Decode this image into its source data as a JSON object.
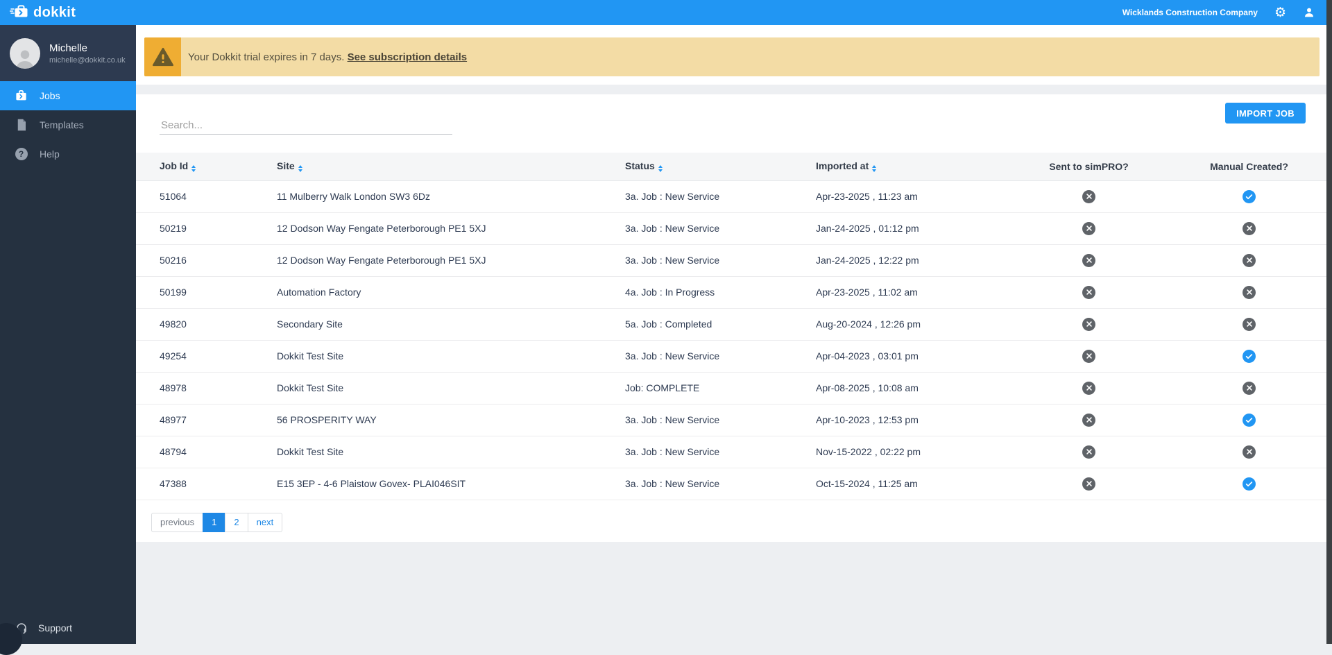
{
  "header": {
    "brand": "dokkit",
    "company": "Wicklands Construction Company"
  },
  "sidebar": {
    "user": {
      "name": "Michelle",
      "email": "michelle@dokkit.co.uk"
    },
    "items": [
      {
        "label": "Jobs",
        "icon": "briefcase-icon",
        "active": true
      },
      {
        "label": "Templates",
        "icon": "file-icon",
        "active": false
      },
      {
        "label": "Help",
        "icon": "question-icon",
        "active": false
      }
    ],
    "support_label": "Support"
  },
  "banner": {
    "message": "Your Dokkit trial expires in 7 days.",
    "link": "See subscription details"
  },
  "toolbar": {
    "search_placeholder": "Search...",
    "import_button": "IMPORT JOB"
  },
  "table": {
    "columns": [
      {
        "label": "Job Id",
        "sortable": true,
        "align": "left"
      },
      {
        "label": "Site",
        "sortable": true,
        "align": "left"
      },
      {
        "label": "Status",
        "sortable": true,
        "align": "left"
      },
      {
        "label": "Imported at",
        "sortable": true,
        "align": "left"
      },
      {
        "label": "Sent to simPRO?",
        "sortable": false,
        "align": "center"
      },
      {
        "label": "Manual Created?",
        "sortable": false,
        "align": "center"
      }
    ],
    "rows": [
      {
        "job_id": "51064",
        "site": "11 Mulberry Walk London SW3 6Dz",
        "status": "3a. Job : New Service",
        "imported_at": "Apr-23-2025 , 11:23 am",
        "sent_to_simpro": false,
        "manual_created": true
      },
      {
        "job_id": "50219",
        "site": "12 Dodson Way Fengate Peterborough PE1 5XJ",
        "status": "3a. Job : New Service",
        "imported_at": "Jan-24-2025 , 01:12 pm",
        "sent_to_simpro": false,
        "manual_created": false
      },
      {
        "job_id": "50216",
        "site": "12 Dodson Way Fengate Peterborough PE1 5XJ",
        "status": "3a. Job : New Service",
        "imported_at": "Jan-24-2025 , 12:22 pm",
        "sent_to_simpro": false,
        "manual_created": false
      },
      {
        "job_id": "50199",
        "site": "Automation Factory",
        "status": "4a. Job : In Progress",
        "imported_at": "Apr-23-2025 , 11:02 am",
        "sent_to_simpro": false,
        "manual_created": false
      },
      {
        "job_id": "49820",
        "site": "Secondary Site",
        "status": "5a. Job : Completed",
        "imported_at": "Aug-20-2024 , 12:26 pm",
        "sent_to_simpro": false,
        "manual_created": false
      },
      {
        "job_id": "49254",
        "site": "Dokkit Test Site",
        "status": "3a. Job : New Service",
        "imported_at": "Apr-04-2023 , 03:01 pm",
        "sent_to_simpro": false,
        "manual_created": true
      },
      {
        "job_id": "48978",
        "site": "Dokkit Test Site",
        "status": "Job: COMPLETE",
        "imported_at": "Apr-08-2025 , 10:08 am",
        "sent_to_simpro": false,
        "manual_created": false
      },
      {
        "job_id": "48977",
        "site": "56 PROSPERITY WAY",
        "status": "3a. Job : New Service",
        "imported_at": "Apr-10-2023 , 12:53 pm",
        "sent_to_simpro": false,
        "manual_created": true
      },
      {
        "job_id": "48794",
        "site": "Dokkit Test Site",
        "status": "3a. Job : New Service",
        "imported_at": "Nov-15-2022 , 02:22 pm",
        "sent_to_simpro": false,
        "manual_created": false
      },
      {
        "job_id": "47388",
        "site": "E15 3EP - 4-6 Plaistow Govex- PLAI046SIT",
        "status": "3a. Job : New Service",
        "imported_at": "Oct-15-2024 , 11:25 am",
        "sent_to_simpro": false,
        "manual_created": true
      }
    ]
  },
  "pagination": {
    "previous_label": "previous",
    "pages": [
      "1",
      "2"
    ],
    "active_page": "1",
    "next_label": "next"
  },
  "colors": {
    "accent": "#2196F3",
    "sidebar_bg": "#253140",
    "profile_bg": "#2D3A50",
    "banner_bg": "#F3DCA5",
    "banner_icon_bg": "#EFAD33",
    "cross_circle": "#5F6368",
    "check_circle": "#2196F3",
    "pagination_active": "#1E88E5"
  }
}
